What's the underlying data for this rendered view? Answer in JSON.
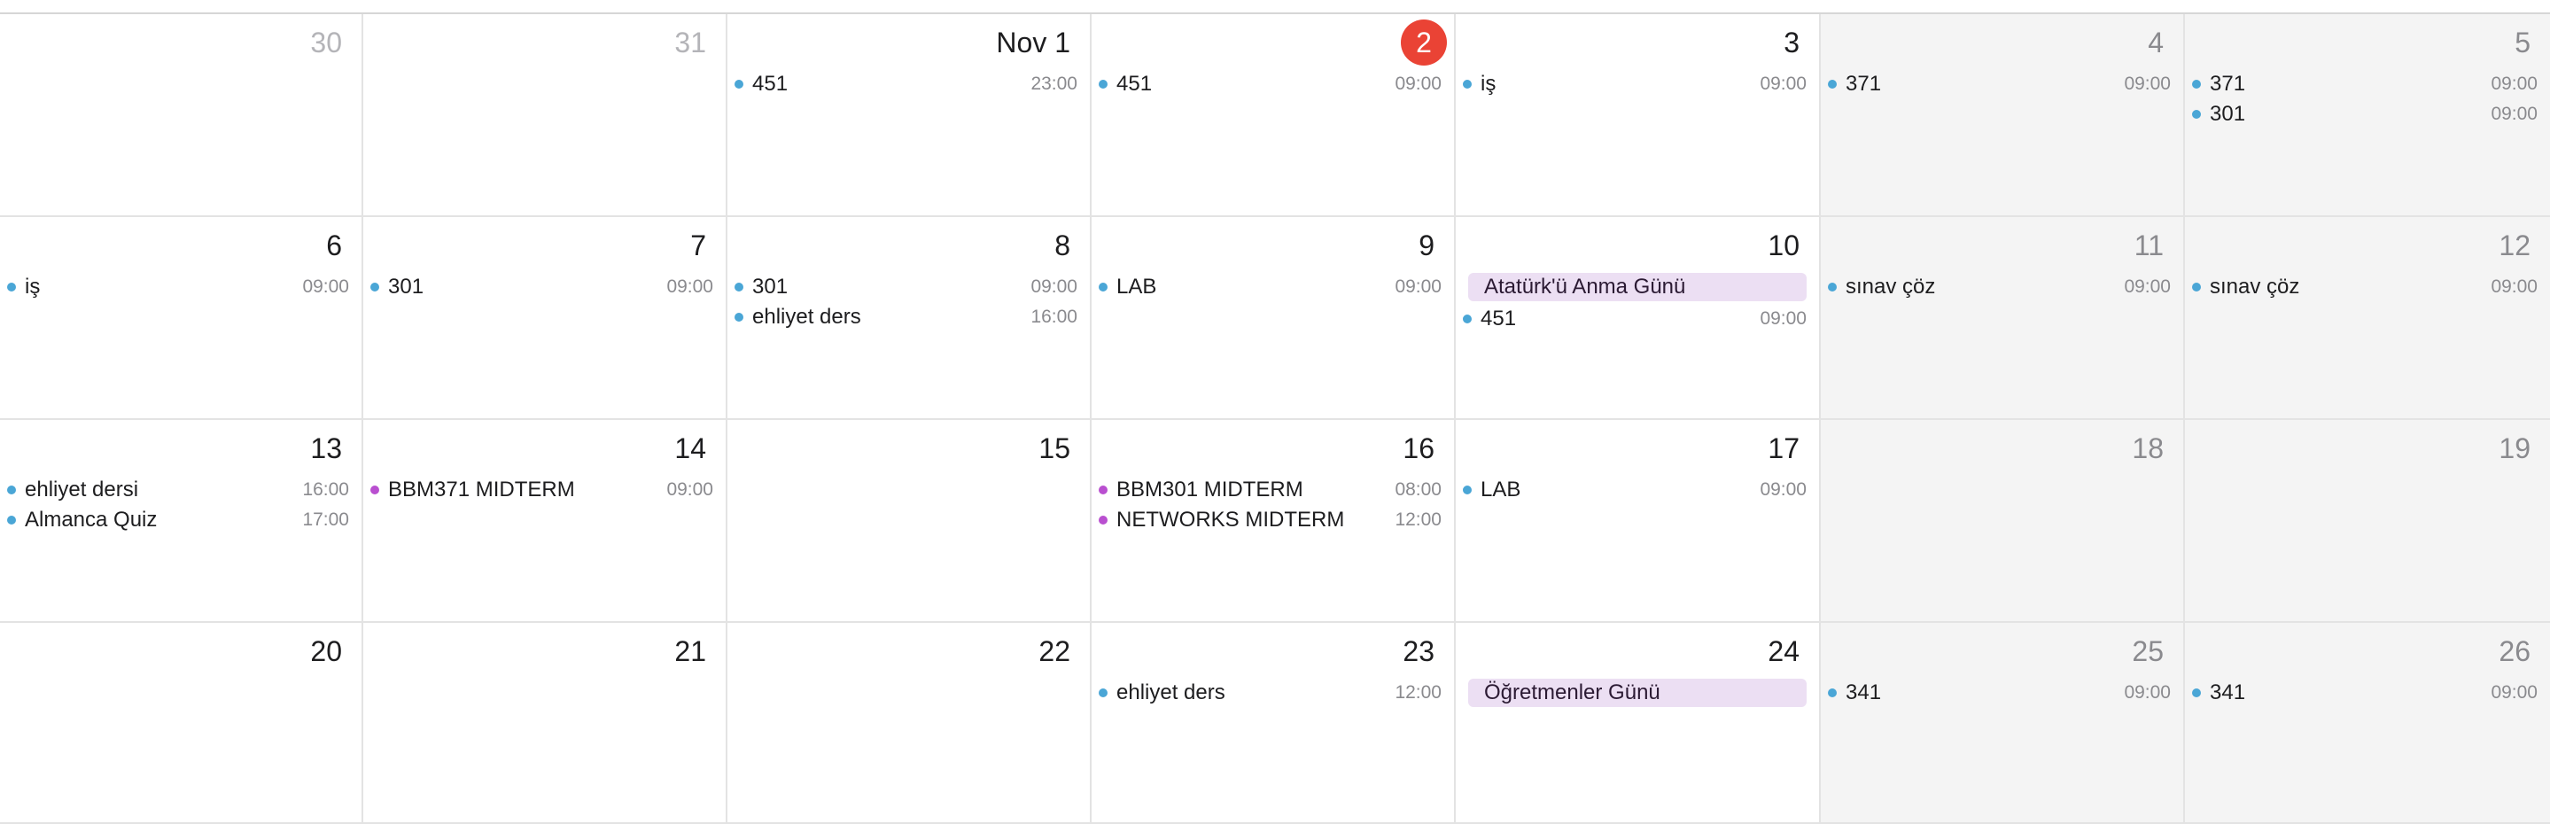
{
  "colors": {
    "calendar_blue": "#4aa6d6",
    "calendar_purple": "#b94fd0",
    "holiday_bg": "#ecdff3",
    "today": "#ea4335"
  },
  "weeks": [
    [
      {
        "label": "30",
        "style": "other-month",
        "weekend": false,
        "events": []
      },
      {
        "label": "31",
        "style": "other-month",
        "weekend": false,
        "events": []
      },
      {
        "label": "Nov 1",
        "style": "normal",
        "weekend": false,
        "events": [
          {
            "title": "451",
            "time": "23:00",
            "color": "blue"
          }
        ]
      },
      {
        "label": "2",
        "style": "today",
        "weekend": false,
        "events": [
          {
            "title": "451",
            "time": "09:00",
            "color": "blue"
          }
        ]
      },
      {
        "label": "3",
        "style": "normal",
        "weekend": false,
        "events": [
          {
            "title": "iş",
            "time": "09:00",
            "color": "blue"
          }
        ]
      },
      {
        "label": "4",
        "style": "weekend",
        "weekend": true,
        "events": [
          {
            "title": "371",
            "time": "09:00",
            "color": "blue"
          }
        ]
      },
      {
        "label": "5",
        "style": "weekend",
        "weekend": true,
        "events": [
          {
            "title": "371",
            "time": "09:00",
            "color": "blue"
          },
          {
            "title": "301",
            "time": "09:00",
            "color": "blue"
          }
        ]
      }
    ],
    [
      {
        "label": "6",
        "style": "normal",
        "weekend": false,
        "events": [
          {
            "title": "iş",
            "time": "09:00",
            "color": "blue"
          }
        ]
      },
      {
        "label": "7",
        "style": "normal",
        "weekend": false,
        "events": [
          {
            "title": "301",
            "time": "09:00",
            "color": "blue"
          }
        ]
      },
      {
        "label": "8",
        "style": "normal",
        "weekend": false,
        "events": [
          {
            "title": "301",
            "time": "09:00",
            "color": "blue"
          },
          {
            "title": "ehliyet ders",
            "time": "16:00",
            "color": "blue"
          }
        ]
      },
      {
        "label": "9",
        "style": "normal",
        "weekend": false,
        "events": [
          {
            "title": "LAB",
            "time": "09:00",
            "color": "blue"
          }
        ]
      },
      {
        "label": "10",
        "style": "normal",
        "weekend": false,
        "allday": "Atatürk'ü Anma Günü",
        "events": [
          {
            "title": "451",
            "time": "09:00",
            "color": "blue"
          }
        ]
      },
      {
        "label": "11",
        "style": "weekend",
        "weekend": true,
        "events": [
          {
            "title": "sınav çöz",
            "time": "09:00",
            "color": "blue"
          }
        ]
      },
      {
        "label": "12",
        "style": "weekend",
        "weekend": true,
        "events": [
          {
            "title": "sınav çöz",
            "time": "09:00",
            "color": "blue"
          }
        ]
      }
    ],
    [
      {
        "label": "13",
        "style": "normal",
        "weekend": false,
        "events": [
          {
            "title": "ehliyet dersi",
            "time": "16:00",
            "color": "blue"
          },
          {
            "title": "Almanca Quiz",
            "time": "17:00",
            "color": "blue"
          }
        ]
      },
      {
        "label": "14",
        "style": "normal",
        "weekend": false,
        "events": [
          {
            "title": "BBM371 MIDTERM",
            "time": "09:00",
            "color": "purple"
          }
        ]
      },
      {
        "label": "15",
        "style": "normal",
        "weekend": false,
        "events": []
      },
      {
        "label": "16",
        "style": "normal",
        "weekend": false,
        "events": [
          {
            "title": "BBM301 MIDTERM",
            "time": "08:00",
            "color": "purple"
          },
          {
            "title": "NETWORKS MIDTERM",
            "time": "12:00",
            "color": "purple"
          }
        ]
      },
      {
        "label": "17",
        "style": "normal",
        "weekend": false,
        "events": [
          {
            "title": "LAB",
            "time": "09:00",
            "color": "blue"
          }
        ]
      },
      {
        "label": "18",
        "style": "weekend",
        "weekend": true,
        "events": []
      },
      {
        "label": "19",
        "style": "weekend",
        "weekend": true,
        "events": []
      }
    ],
    [
      {
        "label": "20",
        "style": "normal",
        "weekend": false,
        "events": []
      },
      {
        "label": "21",
        "style": "normal",
        "weekend": false,
        "events": []
      },
      {
        "label": "22",
        "style": "normal",
        "weekend": false,
        "events": []
      },
      {
        "label": "23",
        "style": "normal",
        "weekend": false,
        "events": [
          {
            "title": "ehliyet ders",
            "time": "12:00",
            "color": "blue"
          }
        ]
      },
      {
        "label": "24",
        "style": "normal",
        "weekend": false,
        "allday": "Öğretmenler Günü",
        "events": []
      },
      {
        "label": "25",
        "style": "weekend",
        "weekend": true,
        "events": [
          {
            "title": "341",
            "time": "09:00",
            "color": "blue"
          }
        ]
      },
      {
        "label": "26",
        "style": "weekend",
        "weekend": true,
        "events": [
          {
            "title": "341",
            "time": "09:00",
            "color": "blue"
          }
        ]
      }
    ]
  ]
}
